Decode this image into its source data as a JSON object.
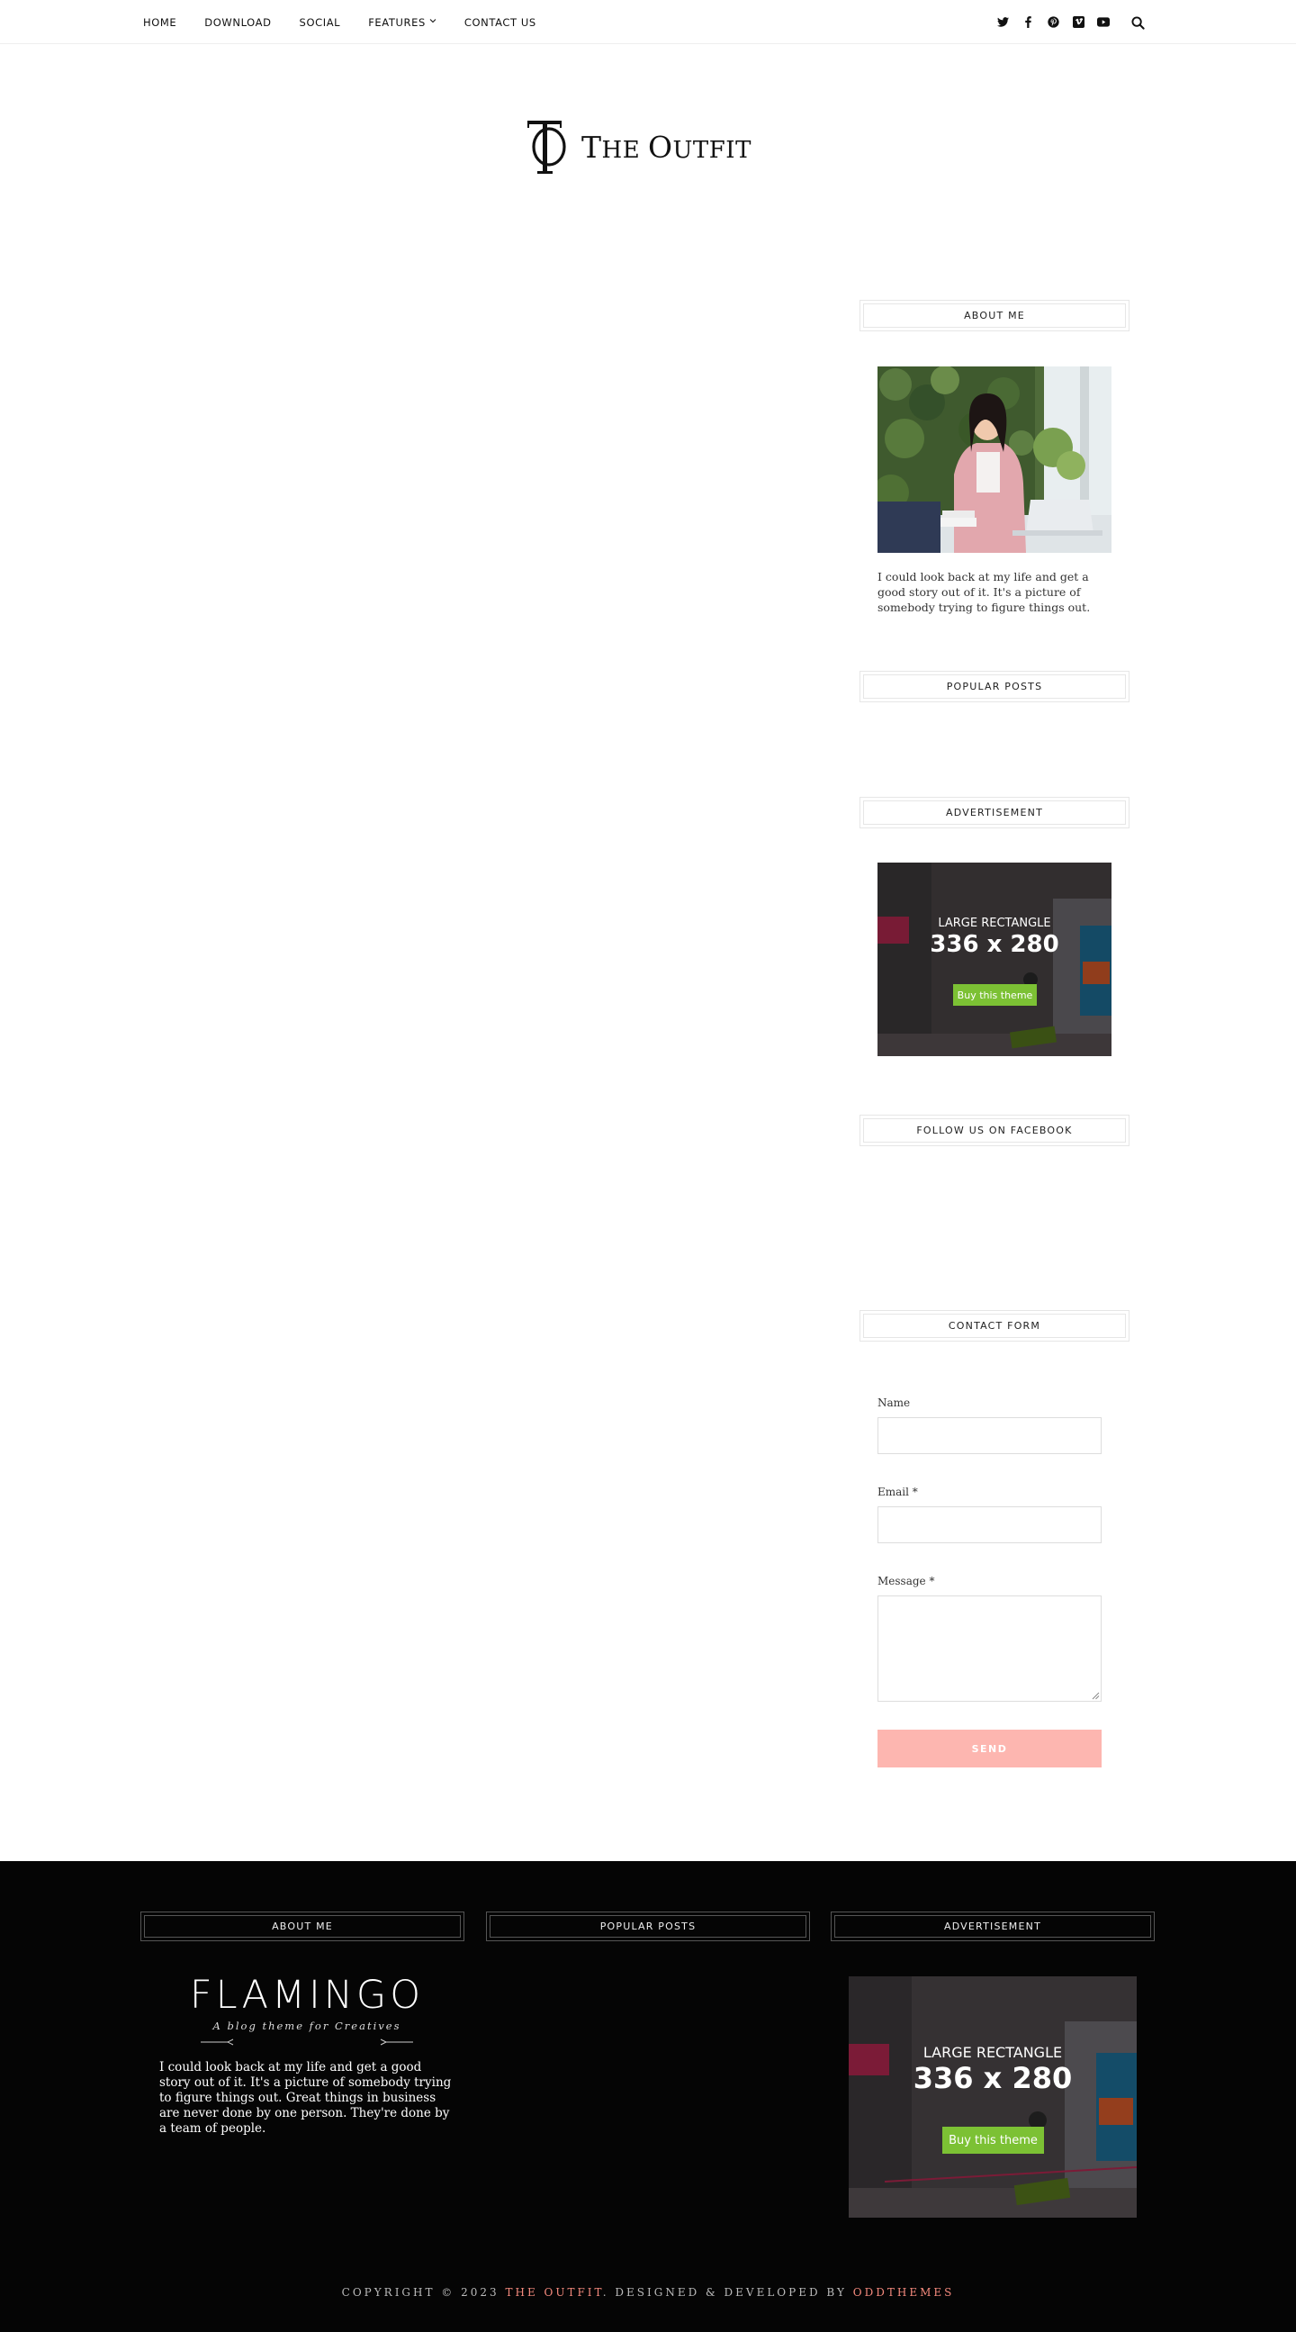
{
  "nav": {
    "items": [
      "HOME",
      "DOWNLOAD",
      "SOCIAL",
      "FEATURES",
      "CONTACT US"
    ]
  },
  "social": {
    "icons": [
      "twitter-icon",
      "facebook-icon",
      "pinterest-icon",
      "vimeo-icon",
      "youtube-icon"
    ],
    "search_icon": "search-icon"
  },
  "logo": {
    "text_the": "T",
    "text_he": "HE ",
    "text_o": "O",
    "text_utfit": "UTFIT"
  },
  "sidebar": {
    "about_title": "ABOUT ME",
    "about_text": "I could look back at my life and get a good story out of it. It's a picture of somebody trying to figure things out.",
    "popular_title": "POPULAR POSTS",
    "ad_title": "ADVERTISEMENT",
    "ad": {
      "line1": "LARGE RECTANGLE",
      "line2": "336 x 280",
      "button": "Buy this theme"
    },
    "facebook_title": "FOLLOW US ON FACEBOOK",
    "contact_title": "CONTACT FORM",
    "form": {
      "name_label": "Name",
      "email_label": "Email",
      "message_label": "Message",
      "required_mark": "*",
      "send_label": "SEND"
    }
  },
  "footer": {
    "about_title": "ABOUT ME",
    "popular_title": "POPULAR POSTS",
    "ad_title": "ADVERTISEMENT",
    "brand_name": "FLAMINGO",
    "brand_tagline": "A blog theme for Creatives",
    "about_text": "I could look back at my life and get a good story out of it. It's a picture of somebody trying to figure things out. Great things in business are never done by one person. They're done by a team of people.",
    "ad": {
      "line1": "LARGE RECTANGLE",
      "line2": "336 x 280",
      "button": "Buy this theme"
    },
    "copyright_prefix": "COPYRIGHT © 2023 ",
    "copyright_site": "THE OUTFIT",
    "copyright_middle": ". DESIGNED & DEVELOPED BY ",
    "copyright_dev": "ODDTHEMES"
  },
  "colors": {
    "accent_pink": "#f58a7d",
    "send_button": "#fdb6b0",
    "footer_bg": "#050505",
    "ad_button": "#7cc134"
  }
}
